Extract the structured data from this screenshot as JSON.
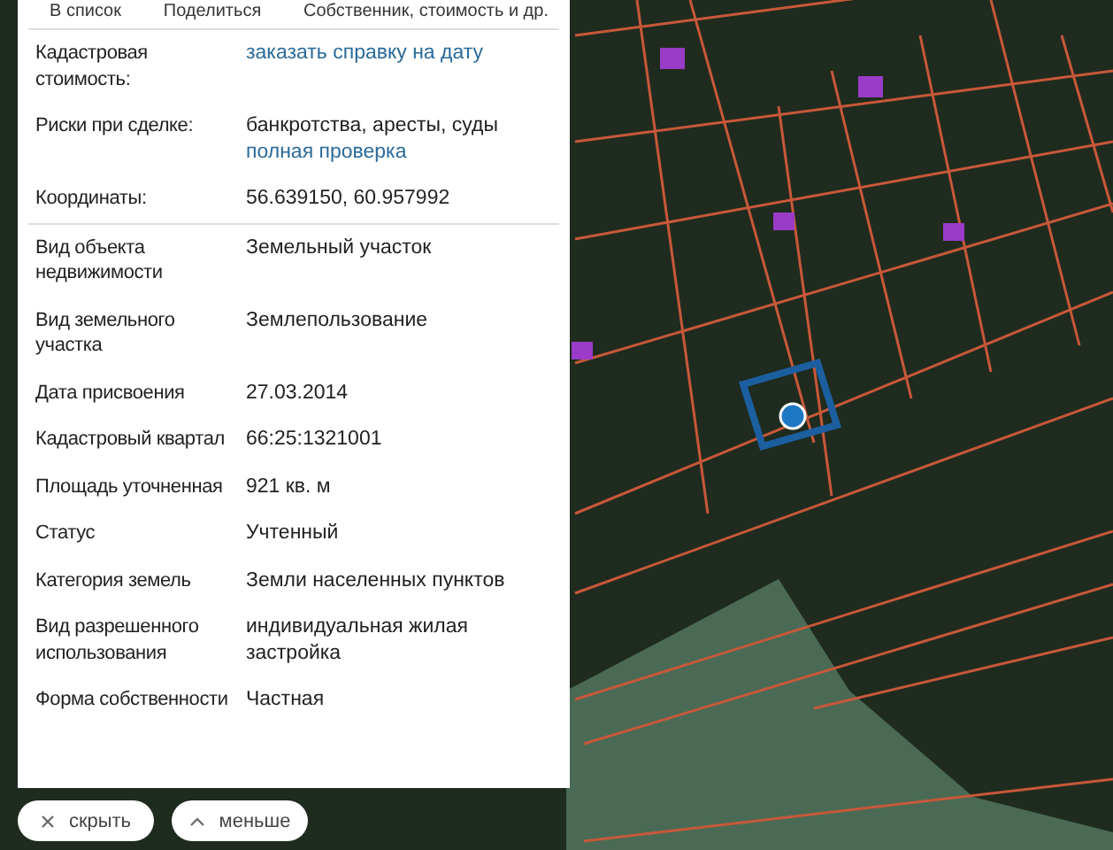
{
  "panel": {
    "tabs": [
      "В список",
      "Поделиться",
      "Собственник, стоимость и др."
    ],
    "sections": [
      {
        "rows": [
          {
            "label": "Кадастровая стоимость:",
            "link": "заказать справку на дату"
          },
          {
            "label": "Риски при сделке:",
            "value": "банкротства, аресты, суды",
            "link": "полная проверка"
          },
          {
            "label": "Координаты:",
            "value": "56.639150, 60.957992"
          }
        ]
      },
      {
        "rows": [
          {
            "label": "Вид объекта недвижимости",
            "value": "Земельный участок"
          },
          {
            "label": "Вид земельного участка",
            "value": "Землепользование"
          },
          {
            "label": "Дата присвоения",
            "value": "27.03.2014"
          },
          {
            "label": "Кадастровый квартал",
            "value": "66:25:1321001"
          },
          {
            "label": "Площадь уточненная",
            "value": "921 кв. м"
          },
          {
            "label": "Статус",
            "value": "Учтенный"
          },
          {
            "label": "Категория земель",
            "value": "Земли населенных пунктов"
          },
          {
            "label": "Вид разрешенного использования",
            "value": "индивидуальная жилая застройка"
          },
          {
            "label": "Форма собственности",
            "value": "Частная"
          }
        ]
      }
    ]
  },
  "buttons": [
    {
      "kind": "hide",
      "label": "скрыть"
    },
    {
      "kind": "less",
      "label": "меньше"
    }
  ]
}
